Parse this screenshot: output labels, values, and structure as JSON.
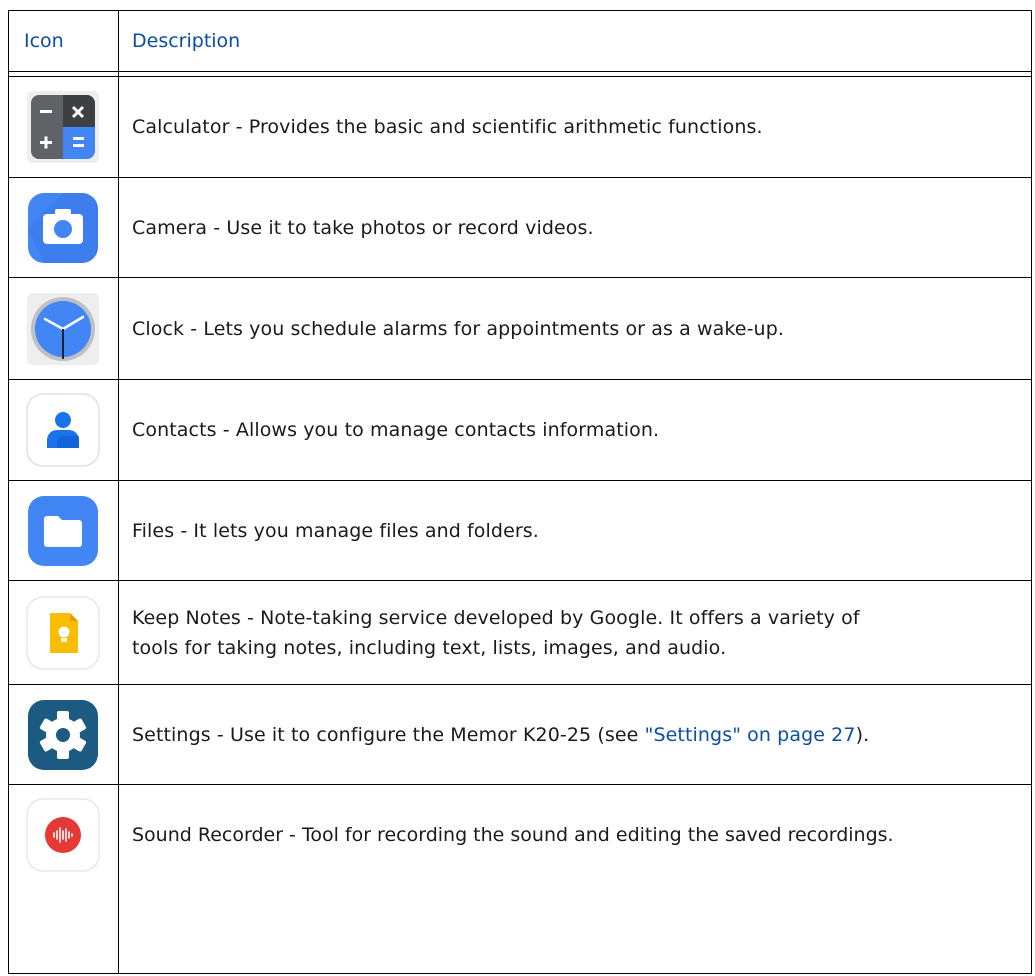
{
  "table": {
    "headers": {
      "icon": "Icon",
      "description": "Description"
    },
    "rows": [
      {
        "icon": "calculator-icon",
        "text": "Calculator - Provides the basic and scientific arithmetic functions."
      },
      {
        "icon": "camera-icon",
        "text": "Camera - Use it to take photos or record videos."
      },
      {
        "icon": "clock-icon",
        "text": "Clock - Lets you schedule alarms for appointments or as a wake-up."
      },
      {
        "icon": "contacts-icon",
        "text": "Contacts - Allows you to manage contacts information."
      },
      {
        "icon": "files-icon",
        "text": "Files - It lets you manage files and folders."
      },
      {
        "icon": "keep-notes-icon",
        "text_line1": "Keep Notes - Note-taking service developed by Google. It offers a variety of",
        "text_line2": "tools for taking notes, including text, lists, images, and audio."
      },
      {
        "icon": "settings-icon",
        "text_before": "Settings - Use it to configure the Memor K20-25 (see ",
        "link": "\"Settings\" on page 27",
        "text_after": ")."
      },
      {
        "icon": "sound-recorder-icon",
        "text": "Sound Recorder - Tool for recording the sound and editing the saved recordings."
      }
    ]
  },
  "colors": {
    "link": "#0b4ea2",
    "text": "#1a1a1a",
    "border": "#000000"
  }
}
